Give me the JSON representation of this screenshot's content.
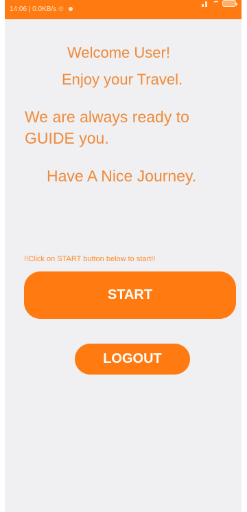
{
  "status_bar": {
    "left_text": "14:06 | 0.0KB/s",
    "icons": [
      "timer-icon",
      "notification-dot-icon",
      "signal-icon",
      "wifi-icon",
      "battery-icon"
    ]
  },
  "content": {
    "welcome": "Welcome User!",
    "enjoy": "Enjoy your Travel.",
    "guide": "We are always ready to GUIDE you.",
    "journey": "Have A Nice Journey.",
    "instruction": "!!Click on START button below to start!!"
  },
  "buttons": {
    "start": "START",
    "logout": "LOGOUT"
  },
  "colors": {
    "accent": "#ff7a10",
    "text": "#ee8a3b",
    "background": "#f0f0f2"
  }
}
